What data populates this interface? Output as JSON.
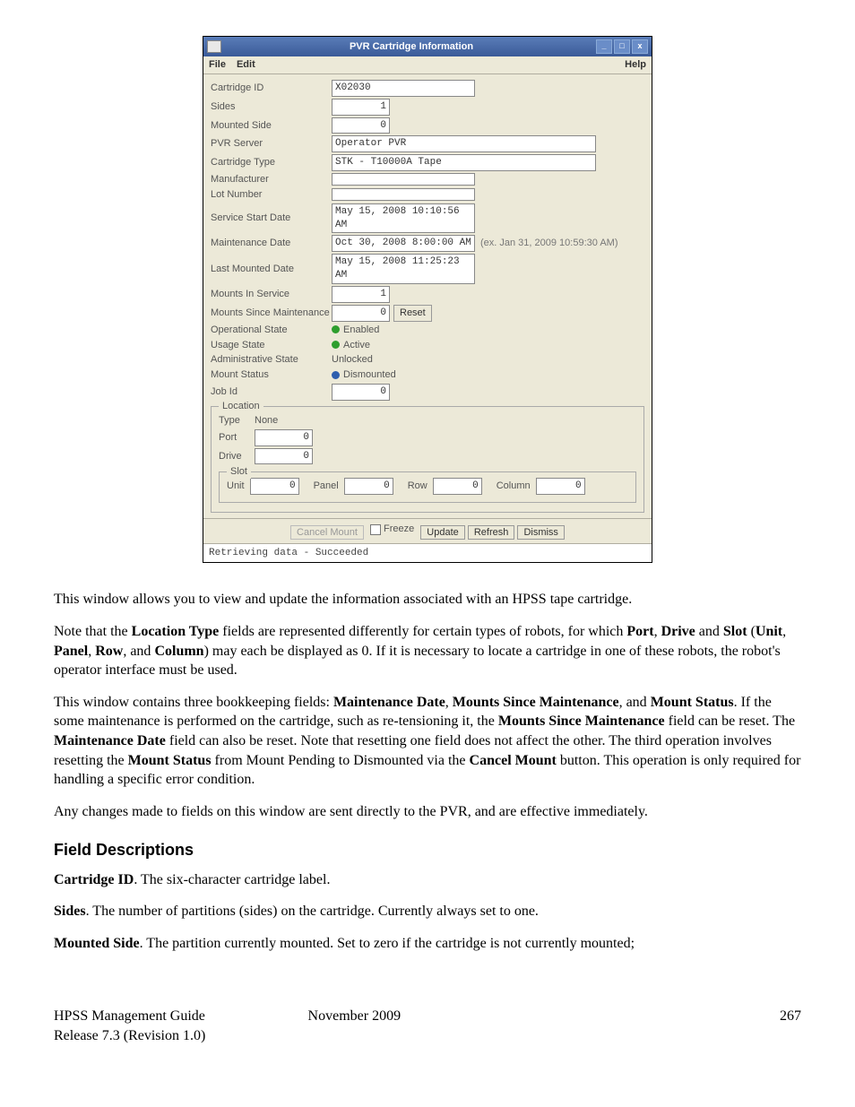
{
  "window": {
    "title": "PVR Cartridge Information",
    "menu": {
      "file": "File",
      "edit": "Edit",
      "help": "Help"
    },
    "labels": {
      "cartridge_id": "Cartridge ID",
      "sides": "Sides",
      "mounted_side": "Mounted Side",
      "pvr_server": "PVR Server",
      "cartridge_type": "Cartridge Type",
      "manufacturer": "Manufacturer",
      "lot_number": "Lot Number",
      "service_start_date": "Service Start Date",
      "maintenance_date": "Maintenance Date",
      "last_mounted_date": "Last Mounted Date",
      "mounts_in_service": "Mounts In Service",
      "mounts_since_maint": "Mounts Since Maintenance",
      "operational_state": "Operational State",
      "usage_state": "Usage State",
      "admin_state": "Administrative State",
      "mount_status": "Mount Status",
      "job_id": "Job Id",
      "location": "Location",
      "type": "Type",
      "port": "Port",
      "drive": "Drive",
      "slot": "Slot",
      "unit": "Unit",
      "panel": "Panel",
      "row": "Row",
      "column": "Column"
    },
    "values": {
      "cartridge_id": "X02030",
      "sides": "1",
      "mounted_side": "0",
      "pvr_server": "Operator PVR",
      "cartridge_type": "STK - T10000A Tape",
      "manufacturer": "",
      "lot_number": "",
      "service_start_date": "May 15, 2008 10:10:56 AM",
      "maintenance_date": "Oct 30, 2008 8:00:00 AM",
      "maintenance_hint": "(ex. Jan 31, 2009 10:59:30 AM)",
      "last_mounted_date": "May 15, 2008 11:25:23 AM",
      "mounts_in_service": "1",
      "mounts_since_maint": "0",
      "operational_state": "Enabled",
      "usage_state": "Active",
      "admin_state": "Unlocked",
      "mount_status": "Dismounted",
      "job_id": "0",
      "location_type": "None",
      "port": "0",
      "drive": "0",
      "unit": "0",
      "panel": "0",
      "row": "0",
      "column": "0"
    },
    "buttons": {
      "reset": "Reset",
      "cancel_mount": "Cancel Mount",
      "freeze": "Freeze",
      "update": "Update",
      "refresh": "Refresh",
      "dismiss": "Dismiss"
    },
    "status": "Retrieving data - Succeeded"
  },
  "prose": {
    "p1": "This window allows you to view and update the information associated with an HPSS tape cartridge.",
    "p2a": "Note that the ",
    "p2b": "Location Type",
    "p2c": " fields are represented differently for certain types of robots, for which ",
    "p2d": "Port",
    "p2e": ", ",
    "p2f": "Drive",
    "p2g": " and ",
    "p2h": "Slot",
    "p2i": " (",
    "p2j": "Unit",
    "p2k": ", ",
    "p2l": "Panel",
    "p2m": ", ",
    "p2n": "Row",
    "p2o": ", and ",
    "p2p": "Column",
    "p2q": ") may each be displayed as 0. If it is necessary to locate a cartridge in one of these robots, the robot's operator interface must be used.",
    "p3a": "This window contains three bookkeeping fields: ",
    "p3b": "Maintenance Date",
    "p3c": ", ",
    "p3d": "Mounts Since Maintenance",
    "p3e": ", and ",
    "p3f": "Mount Status",
    "p3g": ". If the some maintenance is performed on the cartridge, such as re-tensioning it, the ",
    "p3h": "Mounts Since Maintenance",
    "p3i": " field can be reset. The ",
    "p3j": "Maintenance Date",
    "p3k": " field can also be reset. Note that resetting one field does not affect the other. The third operation involves resetting the ",
    "p3l": "Mount Status",
    "p3m": " from Mount Pending to Dismounted via the ",
    "p3n": "Cancel Mount",
    "p3o": " button. This operation is only required for handling a specific error condition.",
    "p4": "Any changes made to fields on this window are sent directly to the PVR, and are effective immediately.",
    "h3": "Field Descriptions",
    "f1a": "Cartridge ID",
    "f1b": ". The six-character cartridge label.",
    "f2a": "Sides",
    "f2b": ". The number of partitions (sides) on the cartridge. Currently always set to one.",
    "f3a": "Mounted Side",
    "f3b": ". The partition currently mounted. Set to zero if the cartridge is not currently mounted;"
  },
  "footer": {
    "left1": "HPSS Management Guide",
    "left2": "Release 7.3 (Revision 1.0)",
    "center": "November 2009",
    "page": "267"
  }
}
